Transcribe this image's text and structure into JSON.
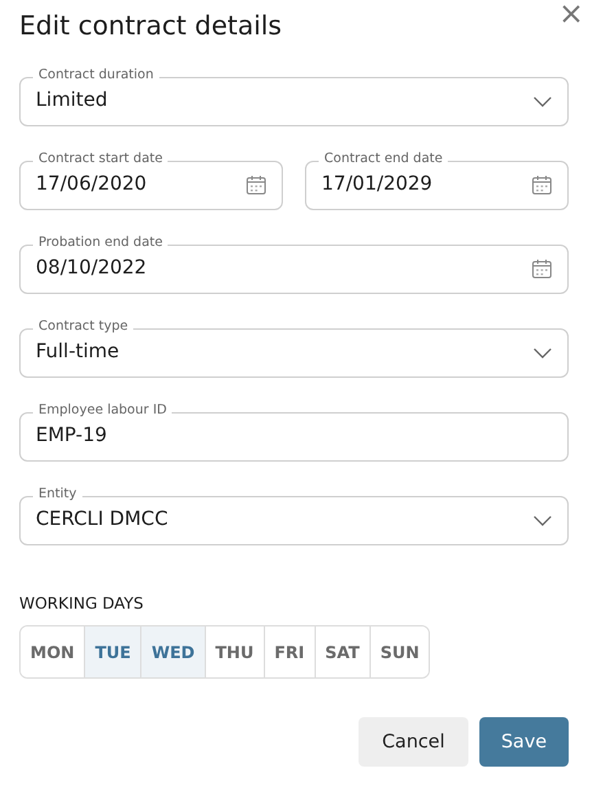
{
  "dialog": {
    "title": "Edit contract details",
    "close": "×"
  },
  "fields": [
    {
      "kind": "select",
      "label": "Contract duration",
      "value": "Limited"
    },
    {
      "kind": "pair",
      "fields": [
        {
          "kind": "date",
          "label": "Contract start date",
          "value": "17/06/2020"
        },
        {
          "kind": "date",
          "label": "Contract end date",
          "value": "17/01/2029"
        }
      ]
    },
    {
      "kind": "date",
      "label": "Probation end date",
      "value": "08/10/2022"
    },
    {
      "kind": "select",
      "label": "Contract type",
      "value": "Full-time"
    },
    {
      "kind": "text",
      "label": "Employee labour ID",
      "value": "EMP-19"
    },
    {
      "kind": "select",
      "label": "Entity",
      "value": "CERCLI DMCC"
    }
  ],
  "working_days": {
    "heading": "WORKING DAYS",
    "days": [
      {
        "label": "MON",
        "selected": false
      },
      {
        "label": "TUE",
        "selected": true
      },
      {
        "label": "WED",
        "selected": true
      },
      {
        "label": "THU",
        "selected": false
      },
      {
        "label": "FRI",
        "selected": false
      },
      {
        "label": "SAT",
        "selected": false
      },
      {
        "label": "SUN",
        "selected": false
      }
    ]
  },
  "buttons": [
    {
      "kind": "secondary",
      "label": "Cancel"
    },
    {
      "kind": "primary",
      "label": "Save"
    }
  ]
}
